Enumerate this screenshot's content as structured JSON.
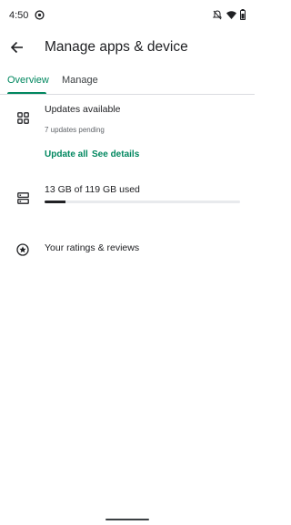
{
  "status_bar": {
    "time": "4:50"
  },
  "app_bar": {
    "title": "Manage apps & device"
  },
  "tabs": [
    {
      "label": "Overview",
      "selected": true
    },
    {
      "label": "Manage",
      "selected": false
    }
  ],
  "colors": {
    "accent": "#01875f",
    "text_primary": "#202124",
    "text_secondary": "#5f6368",
    "divider": "#dadce0"
  },
  "updates": {
    "title": "Updates available",
    "subtitle": "7 updates pending",
    "update_all_label": "Update all",
    "see_details_label": "See details",
    "icon": "apps-grid-icon"
  },
  "storage": {
    "used_text": "13 GB of 119 GB used",
    "used_fraction": 0.109,
    "icon": "storage-icon"
  },
  "ratings": {
    "label": "Your ratings & reviews",
    "icon": "star-circle-icon"
  }
}
